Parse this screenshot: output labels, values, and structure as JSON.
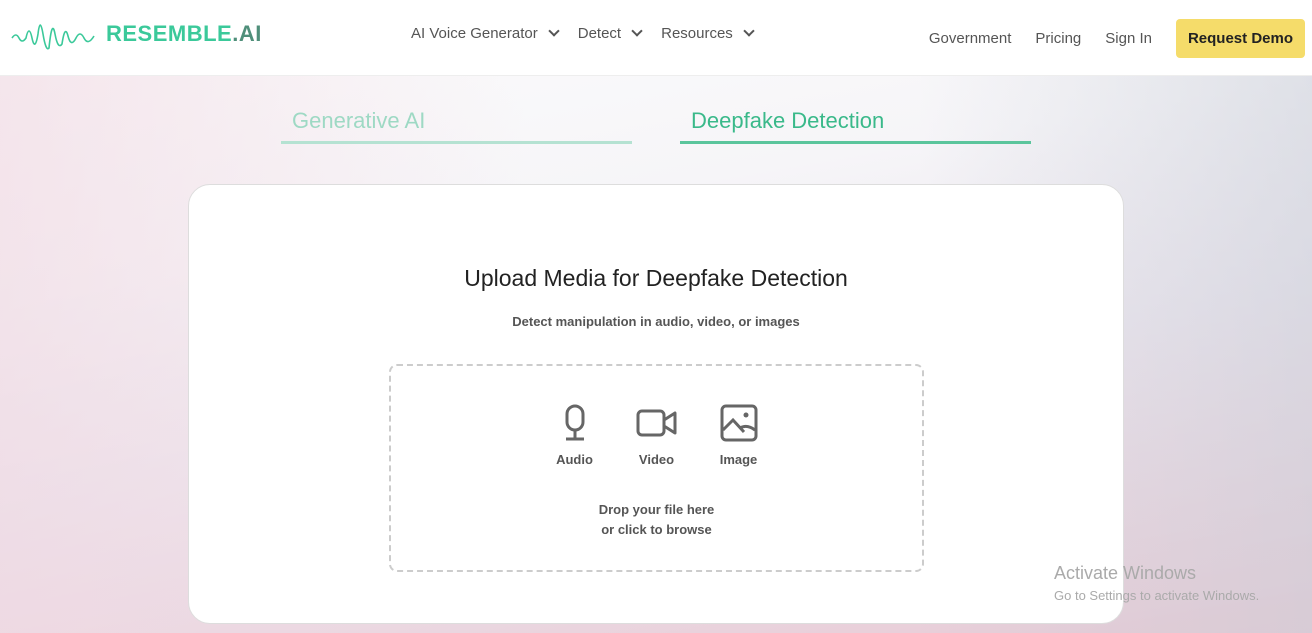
{
  "brand": {
    "name": "RESEMBLE",
    "suffix": ".AI"
  },
  "nav": [
    "AI Voice Generator",
    "Detect",
    "Resources"
  ],
  "right_nav": {
    "government": "Government",
    "pricing": "Pricing",
    "signin": "Sign In",
    "demo": "Request Demo"
  },
  "tabs": {
    "generative": "Generative AI",
    "deepfake": "Deepfake Detection"
  },
  "card": {
    "title": "Upload Media for Deepfake Detection",
    "subtitle": "Detect manipulation in audio, video, or images",
    "types": {
      "audio": "Audio",
      "video": "Video",
      "image": "Image"
    },
    "hint1": "Drop your file here",
    "hint2": "or click to browse"
  },
  "watermark": {
    "title": "Activate Windows",
    "sub": "Go to Settings to activate Windows."
  },
  "colors": {
    "brand": "#3bc99a",
    "demo": "#f5dc6a"
  }
}
